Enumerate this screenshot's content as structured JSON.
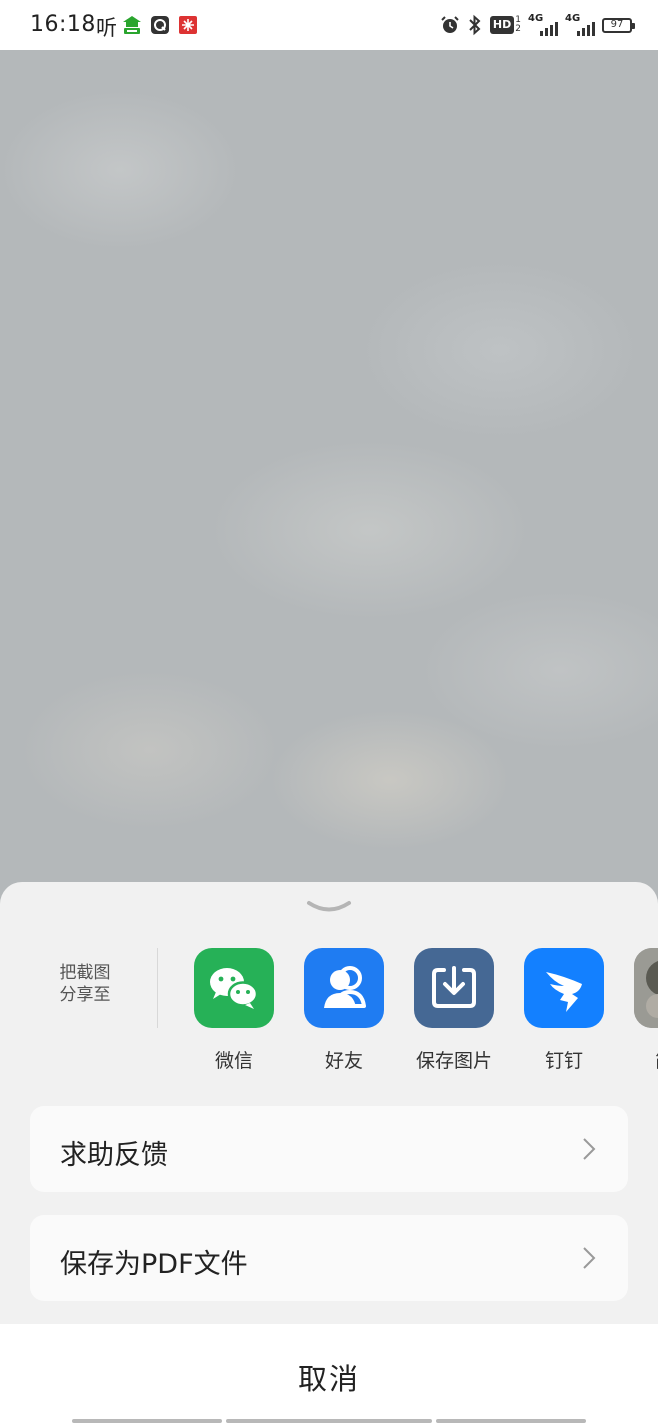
{
  "status_bar": {
    "time": "16:18",
    "listen_label": "听",
    "hd_label": "HD",
    "hd_sub_top": "1",
    "hd_sub_bottom": "2",
    "network1_label": "4G",
    "network2_label": "4G",
    "battery": "97"
  },
  "share_sheet": {
    "share_label_line1": "把截图",
    "share_label_line2": "分享至",
    "apps": [
      {
        "name": "微信",
        "icon": "wechat-icon",
        "color": "#26b157"
      },
      {
        "name": "好友",
        "icon": "friends-icon",
        "color": "#1f7cf2"
      },
      {
        "name": "保存图片",
        "icon": "save-image-icon",
        "color": "#456894"
      },
      {
        "name": "钉钉",
        "icon": "dingtalk-icon",
        "color": "#1380ff"
      },
      {
        "name": "简单",
        "icon": "app-thumbnail-icon",
        "color": "#8a8a8a"
      }
    ],
    "options": [
      {
        "label": "求助反馈"
      },
      {
        "label": "保存为PDF文件"
      }
    ],
    "cancel_label": "取消"
  }
}
